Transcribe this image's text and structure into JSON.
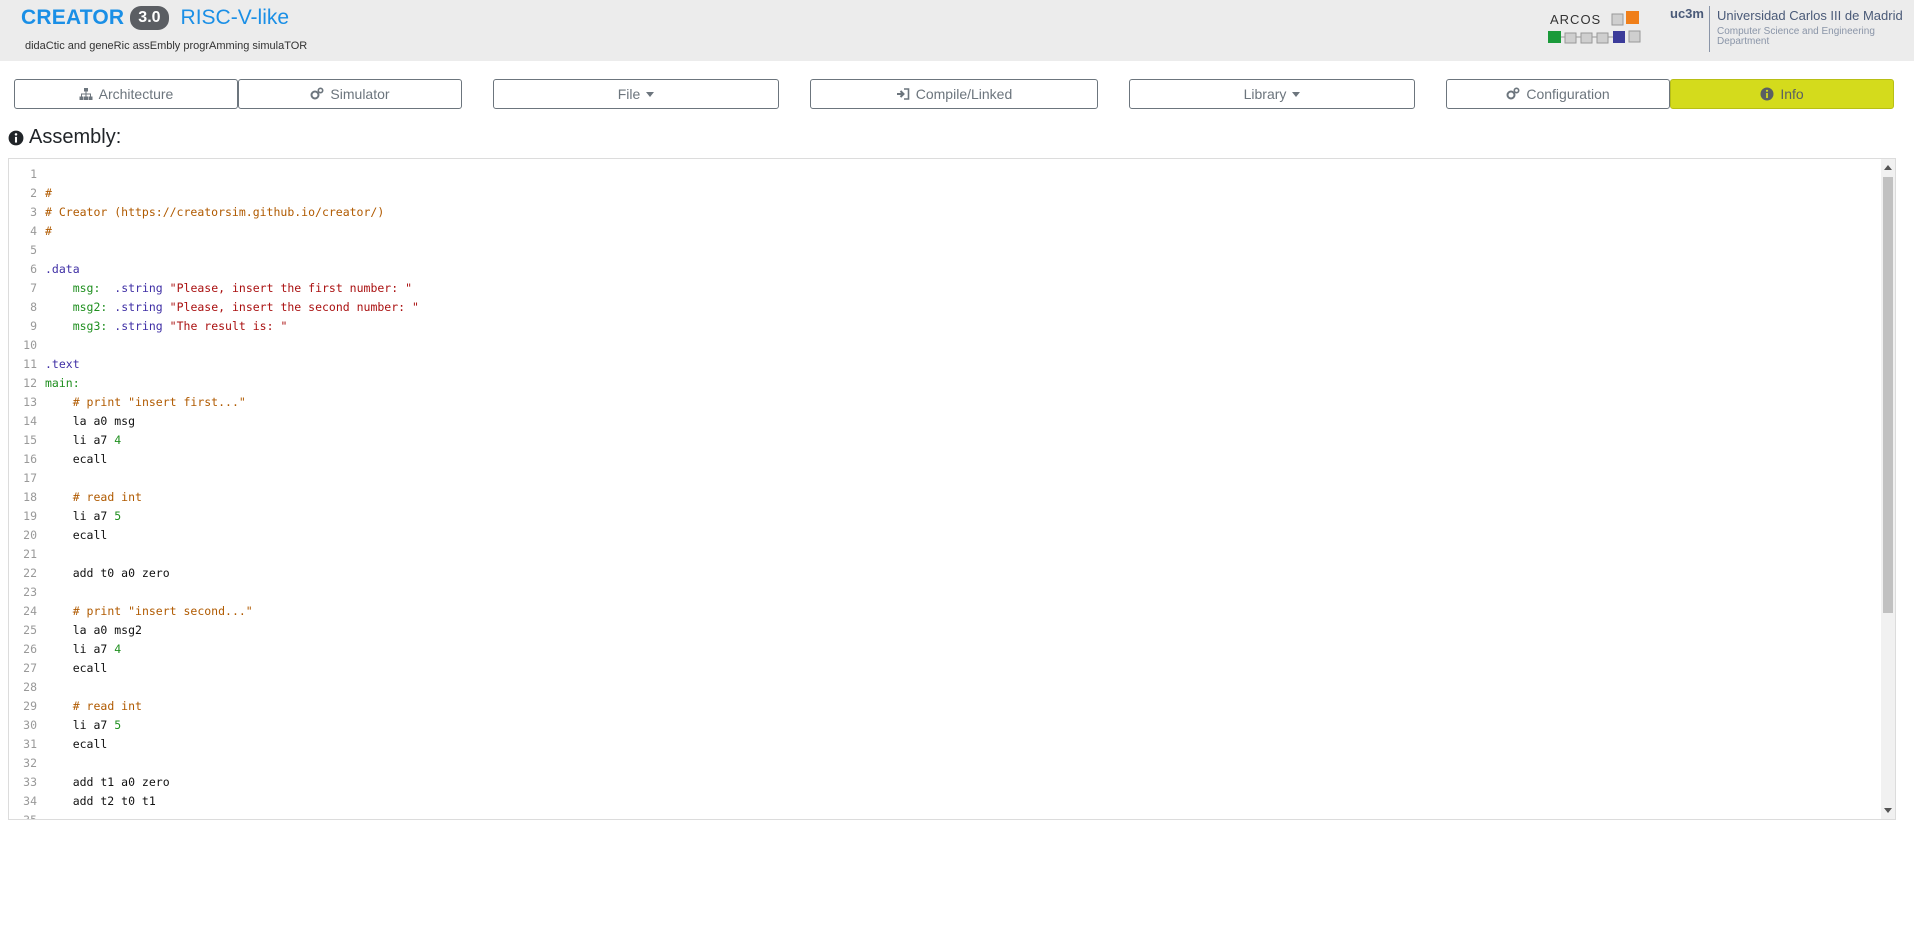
{
  "header": {
    "brand": "CREATOR",
    "version": "3.0",
    "architecture": "RISC-V-like",
    "subtitle": "didaCtic and geneRic assEmbly progrAmming simulaTOR",
    "arcos_logo_text": "ARCOS",
    "uc3m_logo": "uc3m",
    "university": "Universidad Carlos III de Madrid",
    "department": "Computer Science and Engineering Department"
  },
  "toolbar": {
    "architecture": "Architecture",
    "simulator": "Simulator",
    "file": "File",
    "compile": "Compile/Linked",
    "library": "Library",
    "configuration": "Configuration",
    "info": "Info"
  },
  "colors": {
    "accent": "#1a8fe6",
    "info_button": "#d4db1c",
    "header_bg": "#ececec"
  },
  "section": {
    "title": "Assembly:"
  },
  "editor": {
    "lines": [
      [],
      [
        {
          "t": "#",
          "c": "comment"
        }
      ],
      [
        {
          "t": "# Creator (https://creatorsim.github.io/creator/)",
          "c": "comment"
        }
      ],
      [
        {
          "t": "#",
          "c": "comment"
        }
      ],
      [],
      [
        {
          "t": ".data",
          "c": "directive"
        }
      ],
      [
        {
          "t": "    ",
          "c": "plain"
        },
        {
          "t": "msg:",
          "c": "label"
        },
        {
          "t": "  ",
          "c": "plain"
        },
        {
          "t": ".string",
          "c": "directive"
        },
        {
          "t": " ",
          "c": "plain"
        },
        {
          "t": "\"Please, insert the first number: \"",
          "c": "string"
        }
      ],
      [
        {
          "t": "    ",
          "c": "plain"
        },
        {
          "t": "msg2:",
          "c": "label"
        },
        {
          "t": " ",
          "c": "plain"
        },
        {
          "t": ".string",
          "c": "directive"
        },
        {
          "t": " ",
          "c": "plain"
        },
        {
          "t": "\"Please, insert the second number: \"",
          "c": "string"
        }
      ],
      [
        {
          "t": "    ",
          "c": "plain"
        },
        {
          "t": "msg3:",
          "c": "label"
        },
        {
          "t": " ",
          "c": "plain"
        },
        {
          "t": ".string",
          "c": "directive"
        },
        {
          "t": " ",
          "c": "plain"
        },
        {
          "t": "\"The result is: \"",
          "c": "string"
        }
      ],
      [],
      [
        {
          "t": ".text",
          "c": "directive"
        }
      ],
      [
        {
          "t": "main:",
          "c": "label"
        }
      ],
      [
        {
          "t": "    ",
          "c": "plain"
        },
        {
          "t": "# print \"insert first...\"",
          "c": "comment"
        }
      ],
      [
        {
          "t": "    la a0 msg",
          "c": "plain"
        }
      ],
      [
        {
          "t": "    li a7 ",
          "c": "plain"
        },
        {
          "t": "4",
          "c": "num"
        }
      ],
      [
        {
          "t": "    ecall",
          "c": "plain"
        }
      ],
      [],
      [
        {
          "t": "    ",
          "c": "plain"
        },
        {
          "t": "# read int",
          "c": "comment"
        }
      ],
      [
        {
          "t": "    li a7 ",
          "c": "plain"
        },
        {
          "t": "5",
          "c": "num"
        }
      ],
      [
        {
          "t": "    ecall",
          "c": "plain"
        }
      ],
      [],
      [
        {
          "t": "    add t0 a0 zero",
          "c": "plain"
        }
      ],
      [],
      [
        {
          "t": "    ",
          "c": "plain"
        },
        {
          "t": "# print \"insert second...\"",
          "c": "comment"
        }
      ],
      [
        {
          "t": "    la a0 msg2",
          "c": "plain"
        }
      ],
      [
        {
          "t": "    li a7 ",
          "c": "plain"
        },
        {
          "t": "4",
          "c": "num"
        }
      ],
      [
        {
          "t": "    ecall",
          "c": "plain"
        }
      ],
      [],
      [
        {
          "t": "    ",
          "c": "plain"
        },
        {
          "t": "# read int",
          "c": "comment"
        }
      ],
      [
        {
          "t": "    li a7 ",
          "c": "plain"
        },
        {
          "t": "5",
          "c": "num"
        }
      ],
      [
        {
          "t": "    ecall",
          "c": "plain"
        }
      ],
      [],
      [
        {
          "t": "    add t1 a0 zero",
          "c": "plain"
        }
      ],
      [
        {
          "t": "    add t2 t0 t1",
          "c": "plain"
        }
      ],
      []
    ]
  }
}
